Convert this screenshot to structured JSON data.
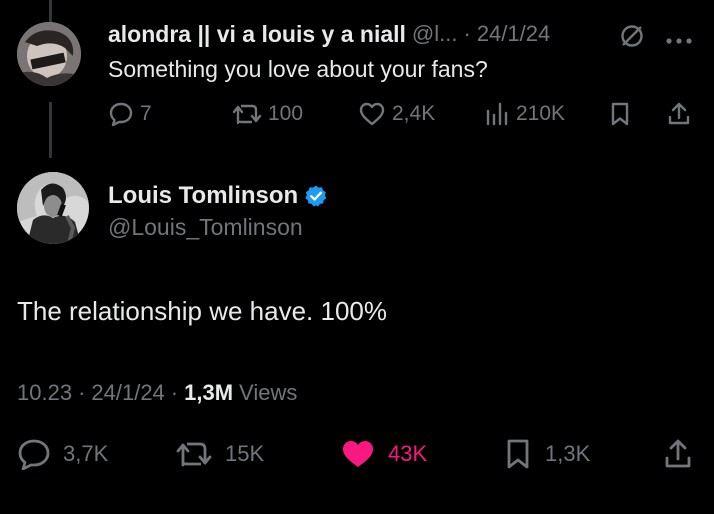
{
  "quoted": {
    "display_name": "alondra || vi a louis y a niall",
    "handle": "@l...",
    "separator": "·",
    "date": "24/1/24",
    "text": "Something you love about your fans?",
    "actions": {
      "replies": "7",
      "retweets": "100",
      "likes": "2,4K",
      "views": "210K"
    }
  },
  "tweet": {
    "display_name": "Louis Tomlinson",
    "handle": "@Louis_Tomlinson",
    "verified": true,
    "text": "The relationship we have. 100%",
    "time": "10.23",
    "separator": "·",
    "date": "24/1/24",
    "views_count": "1,3M",
    "views_label": "Views",
    "actions": {
      "replies": "3,7K",
      "retweets": "15K",
      "likes": "43K",
      "bookmarks": "1,3K"
    }
  },
  "colors": {
    "background": "#000000",
    "primary_text": "#e7e9ea",
    "secondary_text": "#71767b",
    "like_active": "#f91880",
    "verified_badge": "#1d9bf0"
  },
  "icons": {
    "reply": "reply-icon",
    "retweet": "retweet-icon",
    "like": "heart-icon",
    "views": "views-icon",
    "bookmark": "bookmark-icon",
    "share": "share-icon",
    "mute": "mute-icon",
    "more": "more-icon",
    "verified": "verified-badge-icon"
  }
}
